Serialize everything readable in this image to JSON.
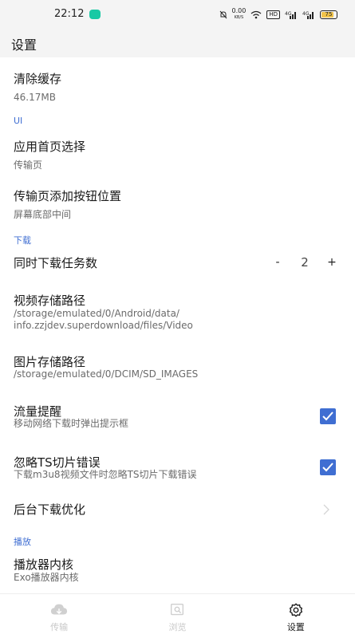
{
  "status_bar": {
    "time": "22:12",
    "net_speed_value": "0.00",
    "net_speed_unit": "KB/S",
    "hd_label": "HD",
    "signal1": "⁴ᴳ",
    "signal2": "⁴ᴳ",
    "battery": "75"
  },
  "appbar": {
    "title": "设置"
  },
  "prefs": {
    "clear_cache": {
      "title": "清除缓存",
      "summary": "46.17MB"
    },
    "section_ui": "UI",
    "home_select": {
      "title": "应用首页选择",
      "summary": "传输页"
    },
    "add_button_pos": {
      "title": "传输页添加按钮位置",
      "summary": "屏幕底部中间"
    },
    "section_download": "下载",
    "concurrent": {
      "title": "同时下载任务数",
      "minus": "-",
      "value": "2",
      "plus": "+"
    },
    "video_path": {
      "title": "视频存储路径",
      "summary_line1": "/storage/emulated/0/Android/data/",
      "summary_line2": "info.zzjdev.superdownload/files/Video"
    },
    "image_path": {
      "title": "图片存储路径",
      "summary": "/storage/emulated/0/DCIM/SD_IMAGES"
    },
    "traffic_alert": {
      "title": "流量提醒",
      "summary": "移动网络下载时弹出提示框",
      "checked": true
    },
    "ignore_ts": {
      "title": "忽略TS切片错误",
      "summary": "下载m3u8视频文件时忽略TS切片下载错误",
      "checked": true
    },
    "bg_optimize": {
      "title": "后台下载优化"
    },
    "section_play": "播放",
    "player_core": {
      "title": "播放器内核",
      "summary": "Exo播放器内核"
    }
  },
  "navbar": {
    "items": [
      {
        "label": "传输",
        "icon": "cloud-download-icon",
        "active": false
      },
      {
        "label": "浏览",
        "icon": "browse-icon",
        "active": false
      },
      {
        "label": "设置",
        "icon": "gear-icon",
        "active": true
      }
    ]
  },
  "colors": {
    "accent": "#3f6ed2",
    "section": "#3f6ed2",
    "inactive_nav": "#c8c8c8"
  }
}
